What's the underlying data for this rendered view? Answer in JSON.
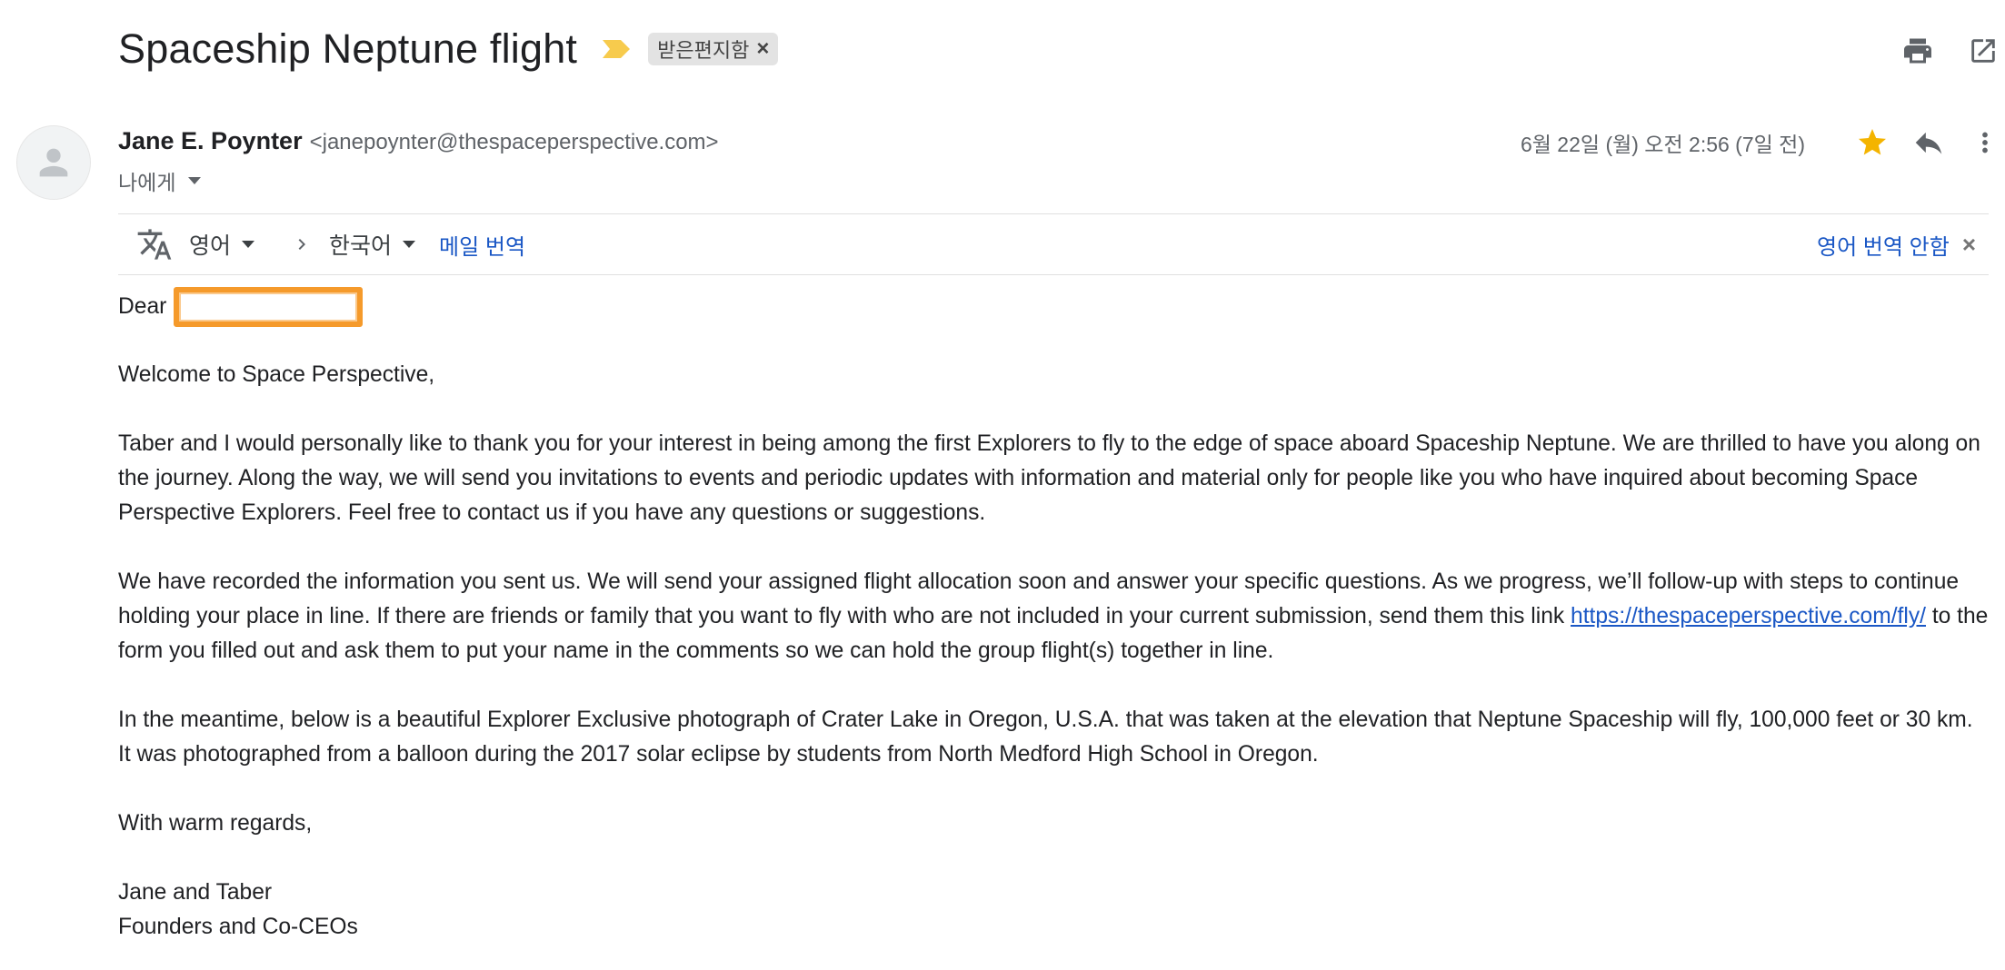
{
  "email": {
    "subject": "Spaceship Neptune flight",
    "label": "받은편지함",
    "label_remove": "×",
    "sender_name": "Jane E. Poynter",
    "sender_email": "<janepoynter@thespaceperspective.com>",
    "recipient": "나에게",
    "date": "6월 22일 (월) 오전 2:56 (7일 전)"
  },
  "icons": {
    "importance": "importance-marker-icon",
    "print": "print-icon",
    "popout": "open-in-new-window-icon",
    "star": "star-icon",
    "reply": "reply-icon",
    "more": "more-vertical-icon",
    "translate": "translate-icon",
    "avatar": "default-avatar-icon"
  },
  "colors": {
    "star": "#f4b400",
    "importance": "#f7cb4d",
    "link": "#1a57c5",
    "redaction": "#f59a2b"
  },
  "translate": {
    "source_lang": "영어",
    "target_lang": "한국어",
    "translate_link": "메일 번역",
    "dont_translate": "영어 번역 안함",
    "close": "×"
  },
  "body": {
    "greeting": "Dear",
    "welcome": "Welcome to Space Perspective,",
    "p1": "Taber and I would personally like to thank you for your interest in being among the first Explorers to fly to the edge of space aboard Spaceship Neptune. We are thrilled to have you along on the journey.  Along the way, we will send you invitations to events and periodic updates with information and material only for people like you who have inquired about becoming Space Perspective Explorers. Feel free to contact us if you have any questions or suggestions.",
    "p2_before": "We have recorded the information you sent us. We will send your assigned flight allocation soon and answer your specific questions. As we progress, we’ll follow-up with steps to continue holding your place in line. If there are friends or family that you want to fly with who are not included in your current submission, send them this link ",
    "p2_link": "https://thespaceperspective.com/fly/",
    "p2_after": " to the form you filled out and ask them to put your name in the comments so we can hold the group flight(s) together in line.",
    "p3": "In the meantime, below is a beautiful Explorer Exclusive photograph of Crater Lake in Oregon, U.S.A. that was taken at the elevation that Neptune Spaceship will fly, 100,000 feet or 30 km. It was photographed from a balloon during the 2017 solar eclipse by students from North Medford High School in Oregon.",
    "closing": "With warm regards,",
    "signature_names": "Jane and Taber",
    "signature_title": "Founders and Co-CEOs"
  }
}
